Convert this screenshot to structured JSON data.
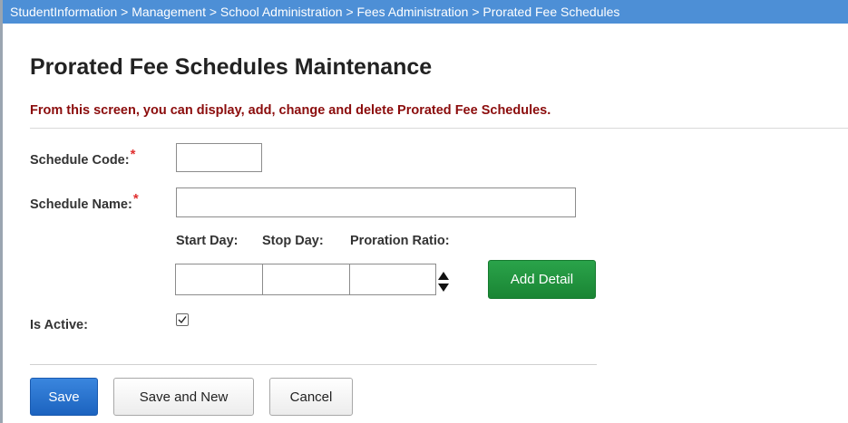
{
  "breadcrumb": "StudentInformation > Management > School Administration > Fees Administration > Prorated Fee Schedules",
  "page_title": "Prorated Fee Schedules Maintenance",
  "instructions": "From this screen, you can display, add, change and delete Prorated Fee Schedules.",
  "required_marker": "*",
  "form": {
    "schedule_code_label": "Schedule Code:",
    "schedule_code_value": "",
    "schedule_name_label": "Schedule Name:",
    "schedule_name_value": "",
    "detail": {
      "start_day_label": "Start Day:",
      "stop_day_label": "Stop Day:",
      "proration_ratio_label": "Proration Ratio:",
      "start_day_value": "",
      "stop_day_value": "",
      "proration_ratio_value": ""
    },
    "add_detail_label": "Add Detail",
    "is_active_label": "Is Active:",
    "is_active_checked": true
  },
  "buttons": {
    "save": "Save",
    "save_and_new": "Save and New",
    "cancel": "Cancel"
  },
  "colors": {
    "breadcrumb_bg": "#4d8fd6",
    "instruction_text": "#8b0c0c",
    "add_detail_bg": "#1f9b3f",
    "save_bg": "#2a72cf",
    "required": "#e03030"
  },
  "icons": {
    "spinner": "up-down-arrows-icon",
    "checkbox": "checkmark-icon"
  }
}
